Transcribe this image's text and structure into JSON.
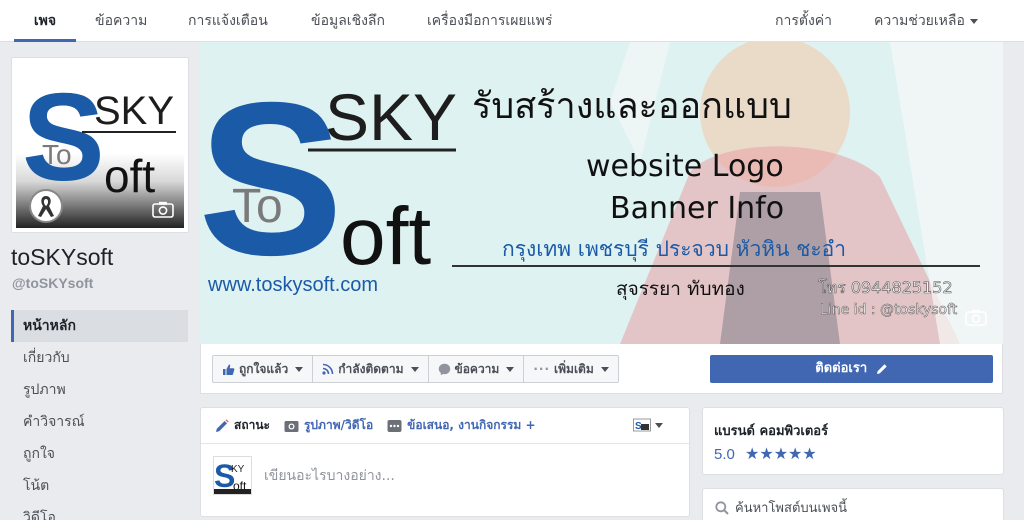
{
  "topbar": {
    "tabs": [
      "เพจ",
      "ข้อความ",
      "การแจ้งเตือน",
      "ข้อมูลเชิงลึก",
      "เครื่องมือการเผยแพร่"
    ],
    "settings": "การตั้งค่า",
    "help": "ความช่วยเหลือ"
  },
  "page": {
    "name": "toSKYsoft",
    "handle": "@toSKYsoft"
  },
  "leftnav": [
    "หน้าหลัก",
    "เกี่ยวกับ",
    "รูปภาพ",
    "คำวิจารณ์",
    "ถูกใจ",
    "โน้ต",
    "วิดีโอ"
  ],
  "cover": {
    "logo_sky": "SKY",
    "logo_s": "S",
    "logo_to": "To",
    "logo_oft": "oft",
    "website": "www.toskysoft.com",
    "headline": "รับสร้างและออกแบบ",
    "line1": "website  Logo",
    "line2": "Banner  Info",
    "areas": "กรุงเทพ เพชรบุรี ประจวบ หัวหิน ชะอำ",
    "contact_name": "สุจรรยา ทับทอง",
    "phone": "โทร 0944825152",
    "line_id": "Line id : @toskysoft"
  },
  "actions": {
    "liked": "ถูกใจแล้ว",
    "following": "กำลังติดตาม",
    "message": "ข้อความ",
    "more": "เพิ่มเติม",
    "contact": "ติดต่อเรา"
  },
  "composer": {
    "status": "สถานะ",
    "photo": "รูปภาพ/วิดีโอ",
    "offer": "ข้อเสนอ, งานกิจกรรม +",
    "placeholder": "เขียนอะไรบางอย่าง..."
  },
  "rating": {
    "category": "แบรนด์ คอมพิวเตอร์",
    "score": "5.0",
    "stars": "★★★★★"
  },
  "search": {
    "placeholder": "ค้นหาโพสต์บนเพจนี้"
  },
  "colors": {
    "brand_blue": "#4267b2",
    "logo_blue": "#1b5aa6"
  }
}
